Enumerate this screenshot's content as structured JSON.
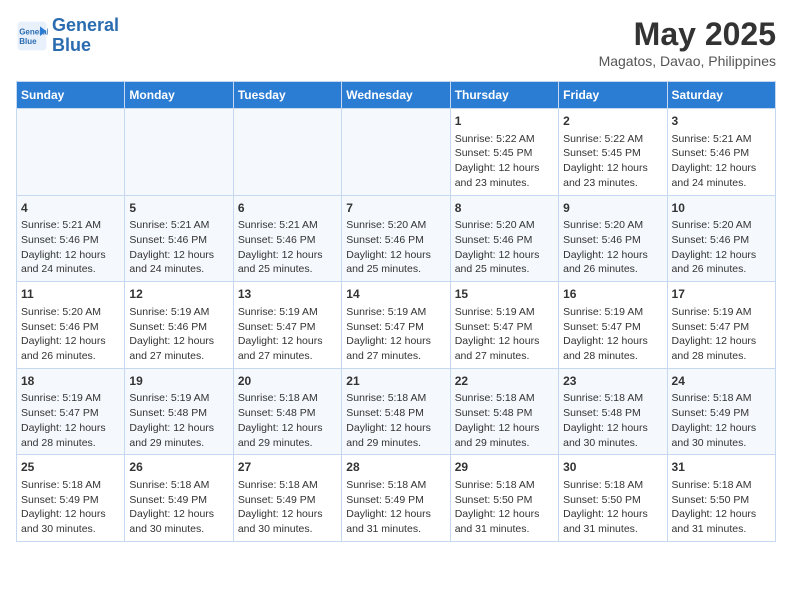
{
  "header": {
    "logo_line1": "General",
    "logo_line2": "Blue",
    "month": "May 2025",
    "location": "Magatos, Davao, Philippines"
  },
  "days_of_week": [
    "Sunday",
    "Monday",
    "Tuesday",
    "Wednesday",
    "Thursday",
    "Friday",
    "Saturday"
  ],
  "weeks": [
    [
      {
        "day": "",
        "info": ""
      },
      {
        "day": "",
        "info": ""
      },
      {
        "day": "",
        "info": ""
      },
      {
        "day": "",
        "info": ""
      },
      {
        "day": "1",
        "info": "Sunrise: 5:22 AM\nSunset: 5:45 PM\nDaylight: 12 hours\nand 23 minutes."
      },
      {
        "day": "2",
        "info": "Sunrise: 5:22 AM\nSunset: 5:45 PM\nDaylight: 12 hours\nand 23 minutes."
      },
      {
        "day": "3",
        "info": "Sunrise: 5:21 AM\nSunset: 5:46 PM\nDaylight: 12 hours\nand 24 minutes."
      }
    ],
    [
      {
        "day": "4",
        "info": "Sunrise: 5:21 AM\nSunset: 5:46 PM\nDaylight: 12 hours\nand 24 minutes."
      },
      {
        "day": "5",
        "info": "Sunrise: 5:21 AM\nSunset: 5:46 PM\nDaylight: 12 hours\nand 24 minutes."
      },
      {
        "day": "6",
        "info": "Sunrise: 5:21 AM\nSunset: 5:46 PM\nDaylight: 12 hours\nand 25 minutes."
      },
      {
        "day": "7",
        "info": "Sunrise: 5:20 AM\nSunset: 5:46 PM\nDaylight: 12 hours\nand 25 minutes."
      },
      {
        "day": "8",
        "info": "Sunrise: 5:20 AM\nSunset: 5:46 PM\nDaylight: 12 hours\nand 25 minutes."
      },
      {
        "day": "9",
        "info": "Sunrise: 5:20 AM\nSunset: 5:46 PM\nDaylight: 12 hours\nand 26 minutes."
      },
      {
        "day": "10",
        "info": "Sunrise: 5:20 AM\nSunset: 5:46 PM\nDaylight: 12 hours\nand 26 minutes."
      }
    ],
    [
      {
        "day": "11",
        "info": "Sunrise: 5:20 AM\nSunset: 5:46 PM\nDaylight: 12 hours\nand 26 minutes."
      },
      {
        "day": "12",
        "info": "Sunrise: 5:19 AM\nSunset: 5:46 PM\nDaylight: 12 hours\nand 27 minutes."
      },
      {
        "day": "13",
        "info": "Sunrise: 5:19 AM\nSunset: 5:47 PM\nDaylight: 12 hours\nand 27 minutes."
      },
      {
        "day": "14",
        "info": "Sunrise: 5:19 AM\nSunset: 5:47 PM\nDaylight: 12 hours\nand 27 minutes."
      },
      {
        "day": "15",
        "info": "Sunrise: 5:19 AM\nSunset: 5:47 PM\nDaylight: 12 hours\nand 27 minutes."
      },
      {
        "day": "16",
        "info": "Sunrise: 5:19 AM\nSunset: 5:47 PM\nDaylight: 12 hours\nand 28 minutes."
      },
      {
        "day": "17",
        "info": "Sunrise: 5:19 AM\nSunset: 5:47 PM\nDaylight: 12 hours\nand 28 minutes."
      }
    ],
    [
      {
        "day": "18",
        "info": "Sunrise: 5:19 AM\nSunset: 5:47 PM\nDaylight: 12 hours\nand 28 minutes."
      },
      {
        "day": "19",
        "info": "Sunrise: 5:19 AM\nSunset: 5:48 PM\nDaylight: 12 hours\nand 29 minutes."
      },
      {
        "day": "20",
        "info": "Sunrise: 5:18 AM\nSunset: 5:48 PM\nDaylight: 12 hours\nand 29 minutes."
      },
      {
        "day": "21",
        "info": "Sunrise: 5:18 AM\nSunset: 5:48 PM\nDaylight: 12 hours\nand 29 minutes."
      },
      {
        "day": "22",
        "info": "Sunrise: 5:18 AM\nSunset: 5:48 PM\nDaylight: 12 hours\nand 29 minutes."
      },
      {
        "day": "23",
        "info": "Sunrise: 5:18 AM\nSunset: 5:48 PM\nDaylight: 12 hours\nand 30 minutes."
      },
      {
        "day": "24",
        "info": "Sunrise: 5:18 AM\nSunset: 5:49 PM\nDaylight: 12 hours\nand 30 minutes."
      }
    ],
    [
      {
        "day": "25",
        "info": "Sunrise: 5:18 AM\nSunset: 5:49 PM\nDaylight: 12 hours\nand 30 minutes."
      },
      {
        "day": "26",
        "info": "Sunrise: 5:18 AM\nSunset: 5:49 PM\nDaylight: 12 hours\nand 30 minutes."
      },
      {
        "day": "27",
        "info": "Sunrise: 5:18 AM\nSunset: 5:49 PM\nDaylight: 12 hours\nand 30 minutes."
      },
      {
        "day": "28",
        "info": "Sunrise: 5:18 AM\nSunset: 5:49 PM\nDaylight: 12 hours\nand 31 minutes."
      },
      {
        "day": "29",
        "info": "Sunrise: 5:18 AM\nSunset: 5:50 PM\nDaylight: 12 hours\nand 31 minutes."
      },
      {
        "day": "30",
        "info": "Sunrise: 5:18 AM\nSunset: 5:50 PM\nDaylight: 12 hours\nand 31 minutes."
      },
      {
        "day": "31",
        "info": "Sunrise: 5:18 AM\nSunset: 5:50 PM\nDaylight: 12 hours\nand 31 minutes."
      }
    ]
  ]
}
